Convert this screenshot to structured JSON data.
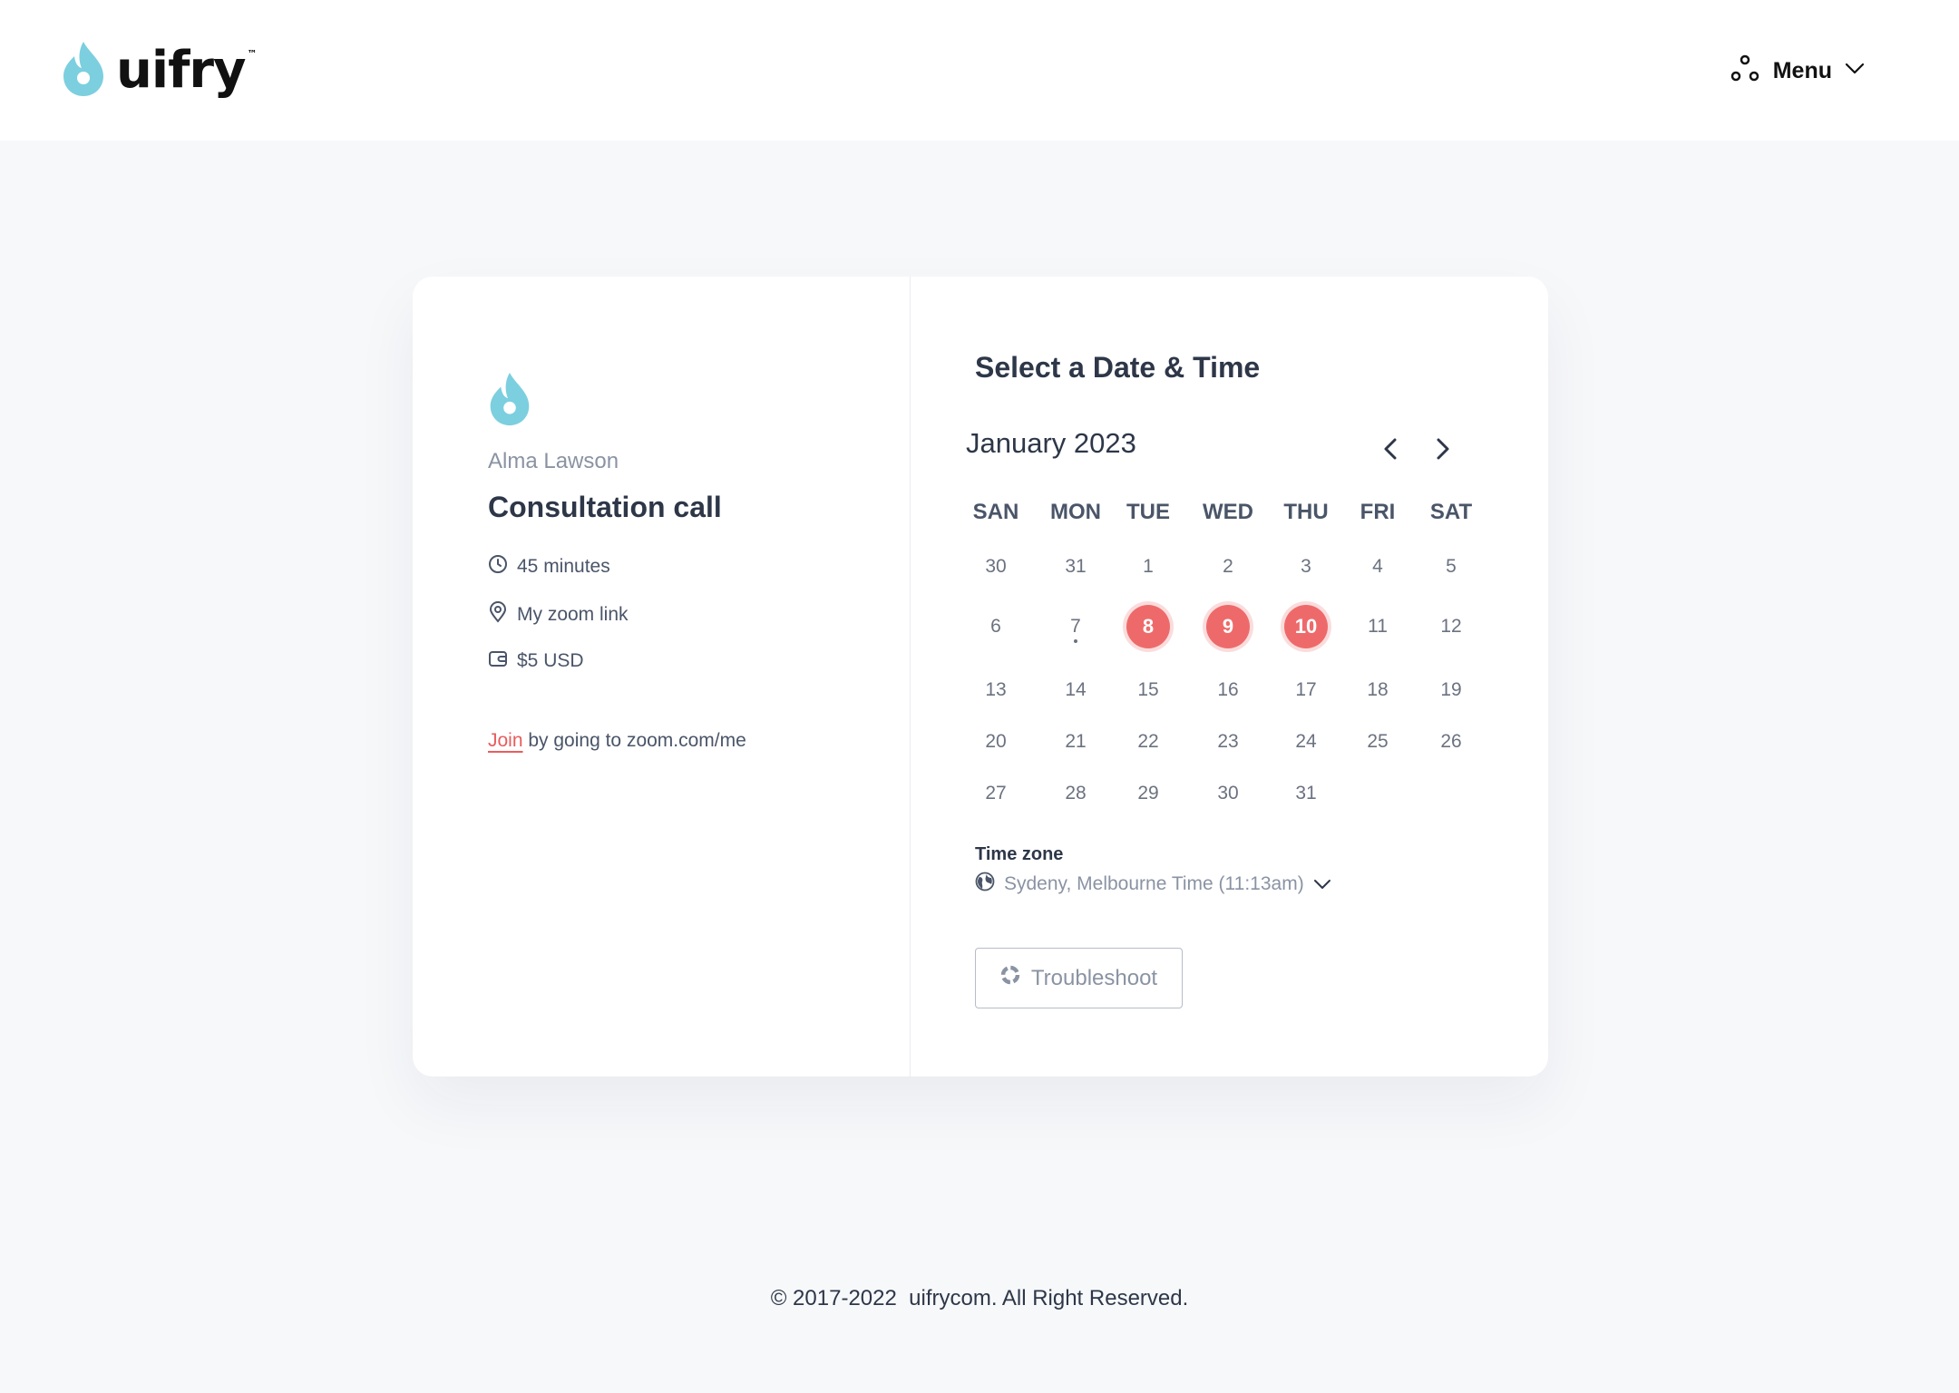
{
  "header": {
    "logo_text": "uifry",
    "logo_tm": "™",
    "menu_label": "Menu"
  },
  "event": {
    "host_name": "Alma Lawson",
    "title": "Consultation call",
    "duration": "45 minutes",
    "location": "My zoom link",
    "price": "$5 USD",
    "join_link": "Join",
    "join_text": " by going to zoom.com/me"
  },
  "calendar": {
    "section_title": "Select a Date & Time",
    "month_label": "January 2023",
    "weekdays": [
      "SAN",
      "MON",
      "TUE",
      "WED",
      "THU",
      "FRI",
      "SAT"
    ],
    "weeks": [
      [
        "30",
        "31",
        "1",
        "2",
        "3",
        "4",
        "5"
      ],
      [
        "6",
        "7",
        "8",
        "9",
        "10",
        "11",
        "12"
      ],
      [
        "13",
        "14",
        "15",
        "16",
        "17",
        "18",
        "19"
      ],
      [
        "20",
        "21",
        "22",
        "23",
        "24",
        "25",
        "26"
      ],
      [
        "27",
        "28",
        "29",
        "30",
        "31",
        "",
        ""
      ]
    ],
    "available_days": [
      "8",
      "9",
      "10"
    ],
    "today": "7"
  },
  "timezone": {
    "label": "Time zone",
    "value": "Sydeny, Melbourne Time (11:13am)"
  },
  "troubleshoot_label": "Troubleshoot",
  "footer": "© 2017-2022  uifrycom. All Right Reserved.",
  "colors": {
    "accent": "#ee6a6a",
    "brand": "#7ccfdf",
    "link": "#e85d5d"
  }
}
